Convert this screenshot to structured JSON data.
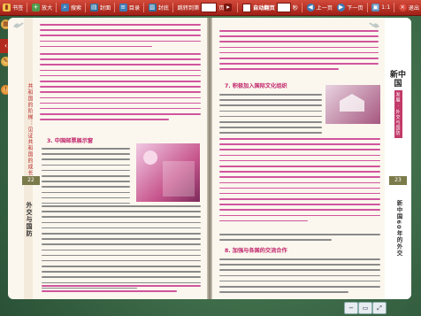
{
  "toolbar": {
    "bookmark": "书签",
    "zoom_in": "放大",
    "search": "搜索",
    "cover": "封面",
    "contents": "目录",
    "back_cover": "封底",
    "goto_label": "跳转到第",
    "goto_unit": "页",
    "auto_flip": "自动翻页",
    "seconds": "秒",
    "prev_page": "上一页",
    "next_page": "下一页",
    "ratio": "1:1",
    "exit": "退出"
  },
  "book": {
    "left_section_title": "3. 中国邮票展示窗",
    "left_running_head": "共和国的阶梯：见证共和国的成长",
    "left_page_number": "22",
    "left_side_label": "外交与国防",
    "right_heading_1": "7. 积极加入国际文化组织",
    "right_heading_2": "8. 加强与各国的交流合作",
    "right_logo": "新中国",
    "right_logo_sub": "发展 · 外交与国防",
    "right_page_number": "23",
    "right_side_label": "新中国60年的外交"
  },
  "colors": {
    "toolbar": "#b8281c",
    "accent_pink": "#c1246b",
    "page": "#fbf7ee",
    "background": "#3f6d4a"
  }
}
